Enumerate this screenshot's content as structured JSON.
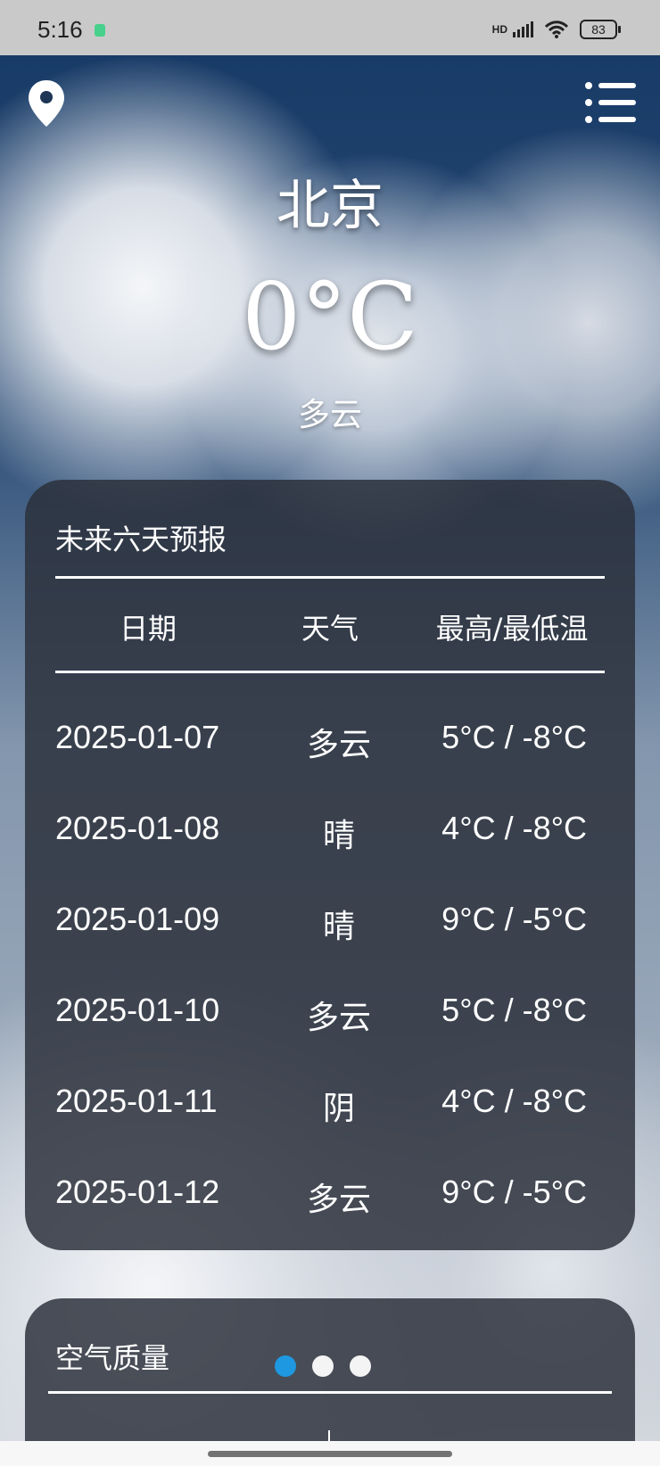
{
  "status_bar": {
    "time": "5:16",
    "network": "HD",
    "battery": "83"
  },
  "location": {
    "city": "北京",
    "temperature": "0°C",
    "condition": "多云"
  },
  "forecast": {
    "title": "未来六天预报",
    "headers": {
      "date": "日期",
      "weather": "天气",
      "temperature": "最高/最低温"
    },
    "rows": [
      {
        "date": "2025-01-07",
        "weather": "多云",
        "temperature": "5°C / -8°C"
      },
      {
        "date": "2025-01-08",
        "weather": "晴",
        "temperature": "4°C / -8°C"
      },
      {
        "date": "2025-01-09",
        "weather": "晴",
        "temperature": "9°C / -5°C"
      },
      {
        "date": "2025-01-10",
        "weather": "多云",
        "temperature": "5°C / -8°C"
      },
      {
        "date": "2025-01-11",
        "weather": "阴",
        "temperature": "4°C / -8°C"
      },
      {
        "date": "2025-01-12",
        "weather": "多云",
        "temperature": "9°C / -5°C"
      }
    ]
  },
  "air_quality": {
    "title": "空气质量"
  },
  "pager": {
    "active_color": "#1e98e0",
    "inactive_color": "#f4f4f4"
  },
  "icons": {
    "location": "location-pin-icon",
    "menu": "menu-icon"
  }
}
